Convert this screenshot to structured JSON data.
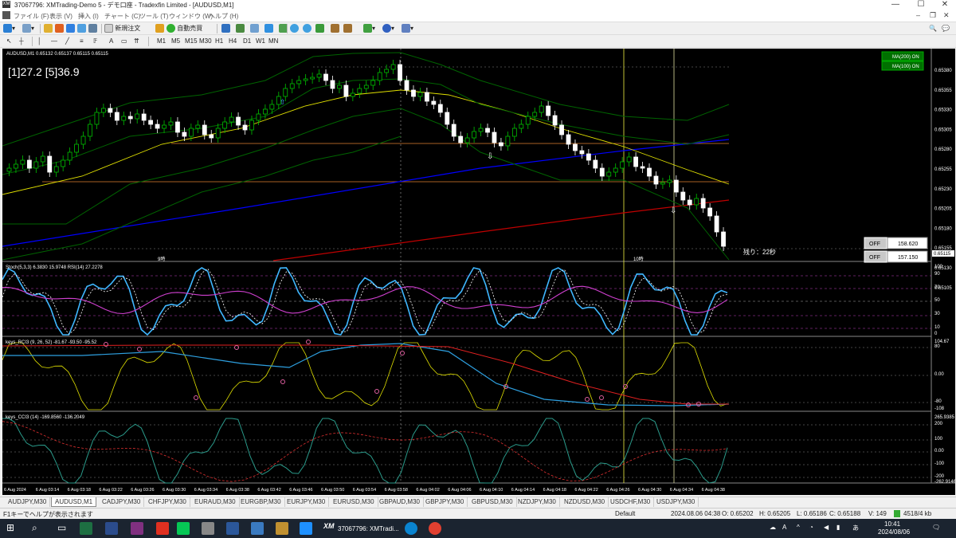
{
  "window": {
    "title": "37067796: XMTrading-Demo 5 - デモ口座 - Tradexfin Limited - [AUDUSD,M1]",
    "min": "—",
    "max": "☐",
    "close": "✕"
  },
  "menu": [
    "ファイル (F)",
    "表示 (V)",
    "挿入 (I)",
    "チャート (C)",
    "ツール (T)",
    "ウィンドウ (W)",
    "ヘルプ (H)"
  ],
  "toolbar": {
    "new_order": "新規注文",
    "auto_trade": "自動売買",
    "timeframes": [
      "M1",
      "M5",
      "M15",
      "M30",
      "H1",
      "H4",
      "D1",
      "W1",
      "MN"
    ]
  },
  "chart": {
    "header": "AUDUSD,M1  0.65132 0.65137 0.65115 0.65115",
    "counter": "[1]27.2 [5]36.9",
    "ma_labels": [
      "MA(200) ON",
      "MA(100) ON"
    ],
    "off_panels": [
      {
        "label": "OFF",
        "value": "158.620"
      },
      {
        "label": "OFF",
        "value": "157.150"
      }
    ],
    "remaining": "残り：22秒",
    "price_label": "0.65115",
    "price_ticks": [
      "0.65380",
      "0.65355",
      "0.65330",
      "0.65305",
      "0.65280",
      "0.65255",
      "0.65230",
      "0.65205",
      "0.65180",
      "0.65155",
      "0.65130",
      "0.65105"
    ],
    "session_labels": [
      "9時",
      "10時"
    ],
    "stoch_header": "Stoch(5,3,3) 6.3830 15.9748  RSI(14) 27.2278",
    "stoch_ticks": [
      "100",
      "90",
      "70",
      "50",
      "30",
      "10",
      "0"
    ],
    "rci_header": "keys_RCI3 (9, 26, 52) -81.67 -93.50 -95.52",
    "rci_ticks": [
      "104.67",
      "80",
      "0.00",
      "-80",
      "-108"
    ],
    "cci_header": "keys_CCI3 (14) -169.8560 -136.2049",
    "cci_ticks": [
      "265.9385",
      "200",
      "100",
      "0.00",
      "-100",
      "-200",
      "-262.9146"
    ],
    "time_labels": [
      "6 Aug 2024",
      "6 Aug 03:14",
      "6 Aug 03:18",
      "6 Aug 03:22",
      "6 Aug 03:26",
      "6 Aug 03:30",
      "6 Aug 03:34",
      "6 Aug 03:38",
      "6 Aug 03:42",
      "6 Aug 03:46",
      "6 Aug 03:50",
      "6 Aug 03:54",
      "6 Aug 03:58",
      "6 Aug 04:02",
      "6 Aug 04:06",
      "6 Aug 04:10",
      "6 Aug 04:14",
      "6 Aug 04:18",
      "6 Aug 04:22",
      "6 Aug 04:26",
      "6 Aug 04:30",
      "6 Aug 04:34",
      "6 Aug 04:38"
    ]
  },
  "tabs": [
    "AUDJPY,M30",
    "AUDUSD,M1",
    "CADJPY,M30",
    "CHFJPY,M30",
    "EURAUD,M30",
    "EURGBP,M30",
    "EURJPY,M30",
    "EURUSD,M30",
    "GBPAUD,M30",
    "GBPJPY,M30",
    "GBPUSD,M30",
    "NZDJPY,M30",
    "NZDUSD,M30",
    "USDCHF,M30",
    "USDJPY,M30"
  ],
  "status": {
    "help": "F1キーでヘルプが表示されます",
    "profile": "Default",
    "time": "2024.08.06 04:38",
    "open": "O: 0.65202",
    "high": "H: 0.65205",
    "low": "L: 0.65186",
    "close": "C: 0.65188",
    "volume": "V: 149",
    "traffic": "4518/4 kb"
  },
  "taskbar": {
    "app": "37067796: XMTradi...",
    "clock": "10:41",
    "date": "2024/08/06"
  },
  "colors": {
    "bull": "#00c000",
    "bear": "#ffffff",
    "bb": "#006400",
    "ma_blue": "#0000ff",
    "ma_red": "#c00000",
    "ma_yellow": "#e0e000",
    "cyan": "#3fb7ff",
    "magenta": "#d040d0"
  }
}
